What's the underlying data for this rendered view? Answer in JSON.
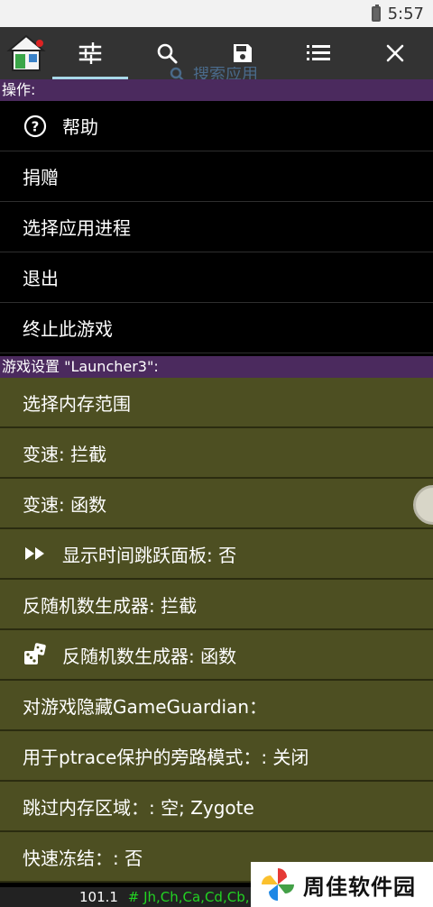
{
  "status_bar": {
    "time": "5:57"
  },
  "toolbar": {
    "icons": [
      "app-logo-icon",
      "sliders-icon",
      "search-icon",
      "save-icon",
      "list-icon",
      "close-icon"
    ],
    "ghost_search_label": "搜索应用"
  },
  "actions_section": {
    "header": "操作:",
    "items": [
      {
        "label": "帮助",
        "icon": "help-icon"
      },
      {
        "label": "捐赠"
      },
      {
        "label": "选择应用进程"
      },
      {
        "label": "退出"
      },
      {
        "label": "终止此游戏"
      }
    ]
  },
  "game_section": {
    "header": "游戏设置 \"Launcher3\":",
    "items": [
      {
        "label": "选择内存范围"
      },
      {
        "label": "变速: 拦截"
      },
      {
        "label": "变速: 函数"
      },
      {
        "label": "显示时间跳跃面板: 否",
        "icon": "fast-forward-icon"
      },
      {
        "label": "反随机数生成器: 拦截"
      },
      {
        "label": "反随机数生成器: 函数",
        "icon": "dice-icon"
      },
      {
        "label": "对游戏隐藏GameGuardian："
      },
      {
        "label": "用于ptrace保护的旁路模式：: 关闭"
      },
      {
        "label": "跳过内存区域：: 空; Zygote"
      },
      {
        "label": "快速冻结：: 否"
      }
    ]
  },
  "bottom_bar": {
    "memory": "101.1",
    "regions": "# Jh,Ch,Ca,Cd,Cb,P"
  },
  "watermark": {
    "text": "周佳软件园"
  },
  "colors": {
    "header_bg": "#4b2a5e",
    "game_item_bg": "#4d4f22",
    "toolbar_bg": "#333333",
    "tab_indicator": "#a8d8e8",
    "regions_text": "#22d322"
  }
}
